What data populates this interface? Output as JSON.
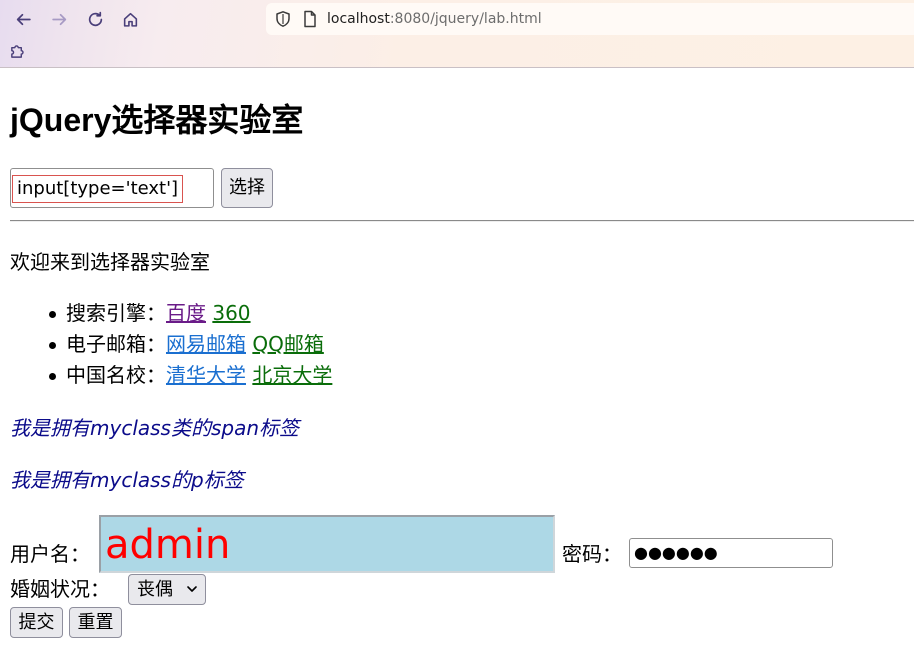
{
  "browser": {
    "url_host": "localhost",
    "url_rest": ":8080/jquery/lab.html",
    "icons": {
      "back": "back-arrow-icon",
      "forward": "forward-arrow-icon",
      "reload": "reload-icon",
      "home": "home-icon",
      "shield": "shield-icon",
      "page": "page-icon",
      "extensions": "puzzle-icon"
    }
  },
  "page": {
    "title": "jQuery选择器实验室",
    "selector_input_value": "input[type='text']",
    "select_button_label": "选择",
    "welcome_text": "欢迎来到选择器实验室",
    "link_groups": [
      {
        "label": "搜索引擎：",
        "links": [
          {
            "text": "百度",
            "style": "visited"
          },
          {
            "text": "360",
            "style": "green"
          }
        ]
      },
      {
        "label": "电子邮箱：",
        "links": [
          {
            "text": "网易邮箱",
            "style": "blue"
          },
          {
            "text": "QQ邮箱",
            "style": "green"
          }
        ]
      },
      {
        "label": "中国名校：",
        "links": [
          {
            "text": "清华大学",
            "style": "blue"
          },
          {
            "text": "北京大学",
            "style": "green"
          }
        ]
      }
    ],
    "myclass_span_text": "我是拥有myclass类的span标签",
    "myclass_p_text": "我是拥有myclass的p标签",
    "form": {
      "username_label": "用户名：",
      "username_value": "admin",
      "password_label": "密码：",
      "password_value": "●●●●●●",
      "marital_label": "婚姻状况：",
      "marital_selected": "丧偶",
      "submit_label": "提交",
      "reset_label": "重置"
    }
  },
  "colors": {
    "visited_link": "#6a1b88",
    "blue_link": "#1a6fd0",
    "green_link": "#0a6d0a",
    "myclass_text": "#0b0b8a",
    "username_bg": "#add8e6",
    "username_text": "#ff0000",
    "selector_highlight_border": "#d9534f"
  }
}
